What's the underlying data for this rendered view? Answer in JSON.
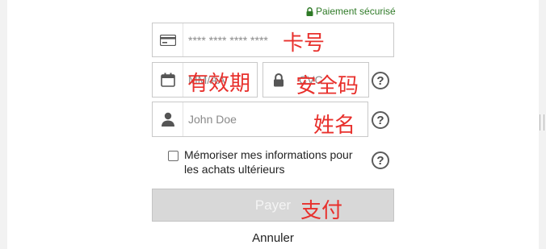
{
  "secure_badge": {
    "text": "Paiement sécurisé",
    "icon": "lock-icon",
    "color": "#2f7a27"
  },
  "card_number": {
    "placeholder": "**** **** **** ****",
    "annotation": "卡号"
  },
  "expiry": {
    "placeholder": "MM/AA",
    "annotation": "有效期"
  },
  "cvc": {
    "placeholder": "CVC",
    "annotation": "安全码"
  },
  "name": {
    "placeholder": "John Doe",
    "annotation": "姓名"
  },
  "remember": {
    "label": "Mémoriser mes informations pour les achats ultérieurs",
    "checked": false
  },
  "help_label": "?",
  "pay_button": {
    "label": "Payer",
    "annotation": "支付",
    "disabled": true
  },
  "cancel_link": {
    "label": "Annuler"
  },
  "colors": {
    "annotation": "#e8302c",
    "accent_green": "#2f7a27",
    "button_disabled": "#d8d8d8"
  }
}
